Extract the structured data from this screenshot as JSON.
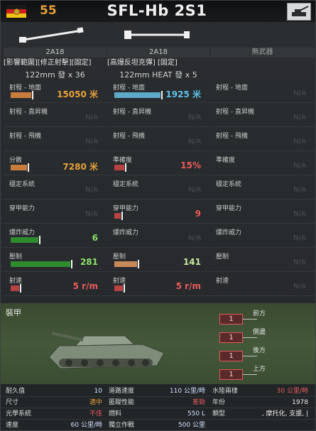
{
  "header": {
    "cost": "55",
    "unit_name": "SFL-Hb 2S1",
    "flag_colors": [
      "#1a1a1a",
      "#d01f1f",
      "#f2c417"
    ],
    "flag_name": "east-germany-flag-icon",
    "category_icon": "self-propelled-artillery-icon"
  },
  "weapons": [
    {
      "name": "2A18",
      "tags": "[影響範圍][修正射擊][固定]",
      "ammo": "122mm 發 x 36",
      "silhouette": "howitzer-barrel-icon",
      "stats": [
        {
          "label": "射程 - 地面",
          "value": "15050 米",
          "fill": 0.25,
          "color": "#c97d3c",
          "cls": "c-orange"
        },
        {
          "label": "射程 - 直昇機",
          "value": "N/A",
          "fill": 0
        },
        {
          "label": "射程 - 飛機",
          "value": "N/A",
          "fill": 0
        },
        {
          "label": "分散",
          "value": "7280 米",
          "fill": 0.2,
          "color": "#c97d3c",
          "cls": "c-orange"
        },
        {
          "label": "穩定系統",
          "value": "N/A",
          "fill": 0
        },
        {
          "label": "穿甲能力",
          "value": "N/A",
          "fill": 0
        },
        {
          "label": "爆炸威力",
          "value": "6",
          "fill": 0.33,
          "color": "#2e8b2e",
          "cls": "c-green"
        },
        {
          "label": "壓制",
          "value": "281",
          "fill": 0.72,
          "color": "#2e8b2e",
          "cls": "c-green"
        },
        {
          "label": "射速",
          "value": "5 r/m",
          "fill": 0.1,
          "color": "#b84242",
          "cls": "c-red"
        }
      ]
    },
    {
      "name": "2A18",
      "tags": "[高爆反坦克彈] [固定]",
      "ammo": "122mm HEAT 發 x 5",
      "silhouette": "howitzer-barrel-heat-icon",
      "stats": [
        {
          "label": "射程 - 地面",
          "value": "1925 米",
          "fill": 0.56,
          "color": "#5ea8c8",
          "cls": "c-cyan"
        },
        {
          "label": "射程 - 直昇機",
          "value": "N/A",
          "fill": 0
        },
        {
          "label": "射程 - 飛機",
          "value": "N/A",
          "fill": 0
        },
        {
          "label": "準確度",
          "value": "15%",
          "fill": 0.12,
          "color": "#b84242",
          "cls": "c-red"
        },
        {
          "label": "穩定系統",
          "value": "N/A",
          "fill": 0
        },
        {
          "label": "穿甲能力",
          "value": "9",
          "fill": 0.08,
          "color": "#b84242",
          "cls": "c-red"
        },
        {
          "label": "爆炸威力",
          "value": "N/A",
          "fill": 0
        },
        {
          "label": "壓制",
          "value": "141",
          "fill": 0.28,
          "color": "#c98a5a",
          "cls": "c-lime"
        },
        {
          "label": "射速",
          "value": "5 r/m",
          "fill": 0.1,
          "color": "#b84242",
          "cls": "c-red"
        }
      ]
    },
    {
      "name": "無武器",
      "tags": "",
      "ammo": "",
      "silhouette": "",
      "stats": [
        {
          "label": "射程 - 地面",
          "value": "N/A",
          "fill": 0
        },
        {
          "label": "射程 - 直昇機",
          "value": "N/A",
          "fill": 0
        },
        {
          "label": "射程 - 飛機",
          "value": "N/A",
          "fill": 0
        },
        {
          "label": "準確度",
          "value": "N/A",
          "fill": 0
        },
        {
          "label": "穩定系統",
          "value": "N/A",
          "fill": 0
        },
        {
          "label": "穿甲能力",
          "value": "N/A",
          "fill": 0
        },
        {
          "label": "爆炸威力",
          "value": "N/A",
          "fill": 0
        },
        {
          "label": "壓制",
          "value": "N/A",
          "fill": 0
        },
        {
          "label": "射速",
          "value": "N/A",
          "fill": 0
        }
      ]
    }
  ],
  "armor": {
    "title": "裝甲",
    "faces": [
      {
        "side": "前方",
        "value": "1"
      },
      {
        "side": "側邊",
        "value": "1"
      },
      {
        "side": "後方",
        "value": "1"
      },
      {
        "side": "上方",
        "value": "1"
      }
    ],
    "image": "2s1-vehicle-icon"
  },
  "properties": [
    [
      {
        "label": "耐久值",
        "value": "10",
        "tone": "ok"
      },
      {
        "label": "道路速度",
        "value": "110 公里/時",
        "tone": "ok"
      },
      {
        "label": "水陸兩棲",
        "value": "30 公里/時",
        "tone": "bad"
      }
    ],
    [
      {
        "label": "尺寸",
        "value": "適中",
        "tone": "warn"
      },
      {
        "label": "匿蹤性能",
        "value": "差勁",
        "tone": "bad"
      },
      {
        "label": "年份",
        "value": "1978",
        "tone": "plain"
      }
    ],
    [
      {
        "label": "光學系統",
        "value": "不佳",
        "tone": "bad"
      },
      {
        "label": "燃料",
        "value": "550 L",
        "tone": "ok"
      },
      {
        "label": "類型",
        "value": ", 摩托化, 支援, |",
        "tone": "plain"
      }
    ],
    [
      {
        "label": "速度",
        "value": "60 公里/時",
        "tone": "ok"
      },
      {
        "label": "獨立作戰",
        "value": "500 公里",
        "tone": "ok"
      },
      {
        "label": "",
        "value": "",
        "tone": "plain"
      }
    ]
  ]
}
